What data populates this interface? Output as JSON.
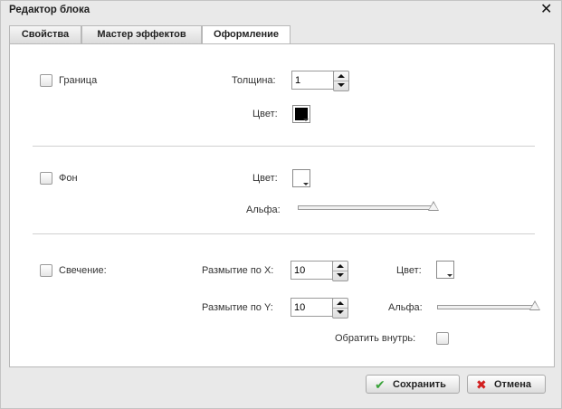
{
  "dialog": {
    "title": "Редактор блока",
    "close_glyph": "✕"
  },
  "tabs": [
    {
      "label": "Свойства",
      "active": false
    },
    {
      "label": "Мастер эффектов",
      "active": false
    },
    {
      "label": "Оформление",
      "active": true
    }
  ],
  "border": {
    "label": "Граница",
    "checked": false,
    "thickness_label": "Толщина:",
    "thickness_value": "1",
    "color_label": "Цвет:",
    "color": "#000000"
  },
  "background": {
    "label": "Фон",
    "checked": false,
    "color_label": "Цвет:",
    "color": "#ffffff",
    "alpha_label": "Альфа:",
    "alpha_value": 1.0
  },
  "glow": {
    "label": "Свечение:",
    "checked": false,
    "blur_x_label": "Размытие по X:",
    "blur_x_value": "10",
    "blur_y_label": "Размытие по Y:",
    "blur_y_value": "10",
    "color_label": "Цвет:",
    "color": "#ffffff",
    "alpha_label": "Альфа:",
    "alpha_value": 1.0,
    "inner_label": "Обратить внутрь:",
    "inner_checked": false
  },
  "footer": {
    "save_label": "Сохранить",
    "save_icon": "check-icon",
    "save_icon_color": "#3aa33a",
    "cancel_label": "Отмена",
    "cancel_icon": "cross-icon",
    "cancel_icon_color": "#d22020"
  }
}
